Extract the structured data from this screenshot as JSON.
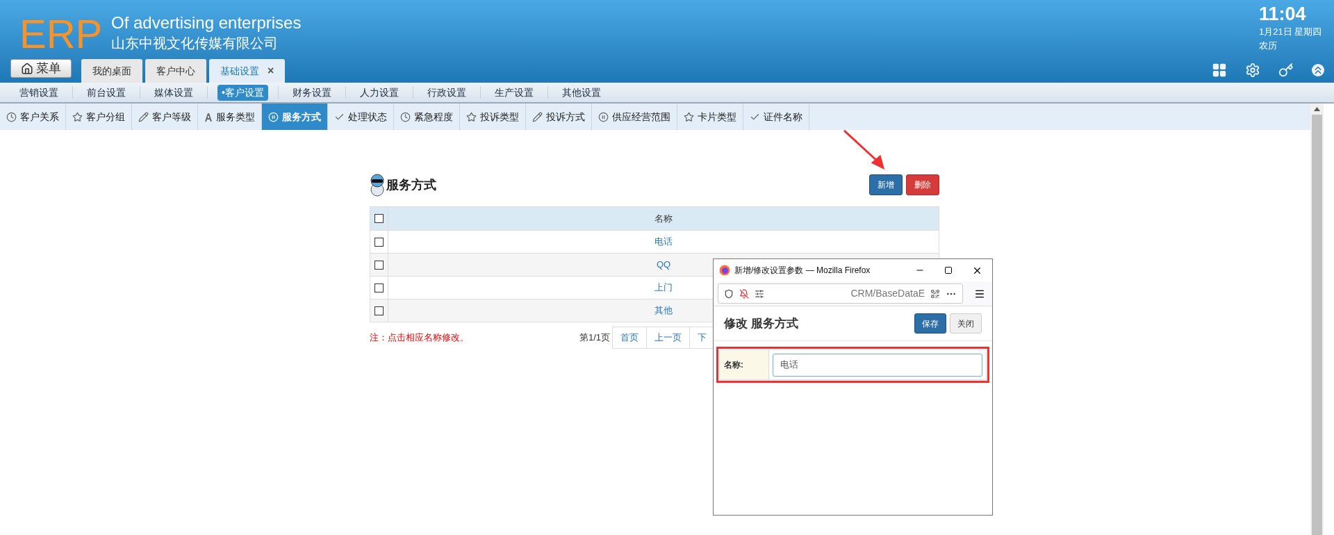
{
  "header": {
    "logo": "ERP",
    "title": "Of advertising enterprises",
    "company": "山东中视文化传媒有限公司",
    "menu_button": "菜单",
    "time": "11:04",
    "date": "1月21日 星期四",
    "lunar": "农历"
  },
  "tabs": [
    {
      "label": "我的桌面",
      "selected": false
    },
    {
      "label": "客户中心",
      "selected": false
    },
    {
      "label": "基础设置",
      "selected": true,
      "close": "×"
    }
  ],
  "nav": [
    {
      "label": "营销设置",
      "selected": false
    },
    {
      "label": "前台设置",
      "selected": false
    },
    {
      "label": "媒体设置",
      "selected": false
    },
    {
      "label": "•客户设置",
      "selected": true
    },
    {
      "label": "财务设置",
      "selected": false
    },
    {
      "label": "人力设置",
      "selected": false
    },
    {
      "label": "行政设置",
      "selected": false
    },
    {
      "label": "生产设置",
      "selected": false
    },
    {
      "label": "其他设置",
      "selected": false
    }
  ],
  "subnav": [
    {
      "label": "客户关系",
      "selected": false
    },
    {
      "label": "客户分组",
      "selected": false
    },
    {
      "label": "客户等级",
      "selected": false
    },
    {
      "label": "服务类型",
      "selected": false
    },
    {
      "label": "服务方式",
      "selected": true
    },
    {
      "label": "处理状态",
      "selected": false
    },
    {
      "label": "紧急程度",
      "selected": false
    },
    {
      "label": "投诉类型",
      "selected": false
    },
    {
      "label": "投诉方式",
      "selected": false
    },
    {
      "label": "供应经营范围",
      "selected": false
    },
    {
      "label": "卡片类型",
      "selected": false
    },
    {
      "label": "证件名称",
      "selected": false
    }
  ],
  "page": {
    "title": "服务方式",
    "buttons": [
      {
        "label": "新增",
        "kind": "primary"
      },
      {
        "label": "删除",
        "kind": "danger"
      }
    ],
    "table": {
      "columns": [
        "名称"
      ],
      "header_checked": false,
      "rows": [
        {
          "name": "电话",
          "checked": false
        },
        {
          "name": "QQ",
          "checked": false
        },
        {
          "name": "上门",
          "checked": false
        },
        {
          "name": "其他",
          "checked": false
        }
      ]
    },
    "note": "注：点击相应名称修改。",
    "page_info": "第1/1页",
    "pager": [
      "首页",
      "上一页",
      "下"
    ]
  },
  "popup": {
    "window_title": "新增/修改设置参数 — Mozilla Firefox",
    "url": "CRM/BaseDataE",
    "heading": "修改 服务方式",
    "buttons": [
      {
        "label": "保存",
        "kind": "primary"
      },
      {
        "label": "关闭",
        "kind": "default"
      }
    ],
    "field": {
      "label": "名称:",
      "value": "电话"
    }
  }
}
